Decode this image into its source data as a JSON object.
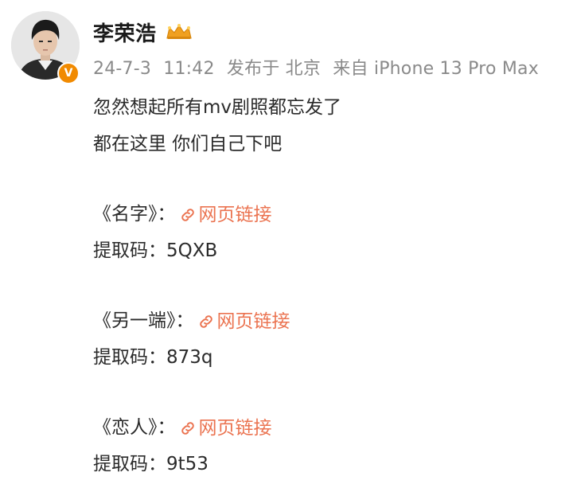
{
  "user": {
    "name": "李荣浩",
    "badge": "V",
    "colors": {
      "verified": "#f18a00",
      "crown": "#f0a020"
    }
  },
  "meta": {
    "date": "24-7-3",
    "time": "11:42",
    "location": "发布于 北京",
    "source": "来自 iPhone 13 Pro Max"
  },
  "post": {
    "line1": "忽然想起所有mv剧照都忘发了",
    "line2": "都在这里 你们自己下吧",
    "items": [
      {
        "title": "《名字》：",
        "link": "网页链接",
        "code_label": "提取码：",
        "code": "5QXB"
      },
      {
        "title": "《另一端》：",
        "link": "网页链接",
        "code_label": "提取码：",
        "code": "873q"
      },
      {
        "title": "《恋人》：",
        "link": "网页链接",
        "code_label": "提取码：",
        "code": "9t53"
      }
    ],
    "link_color": "#eb7350"
  }
}
